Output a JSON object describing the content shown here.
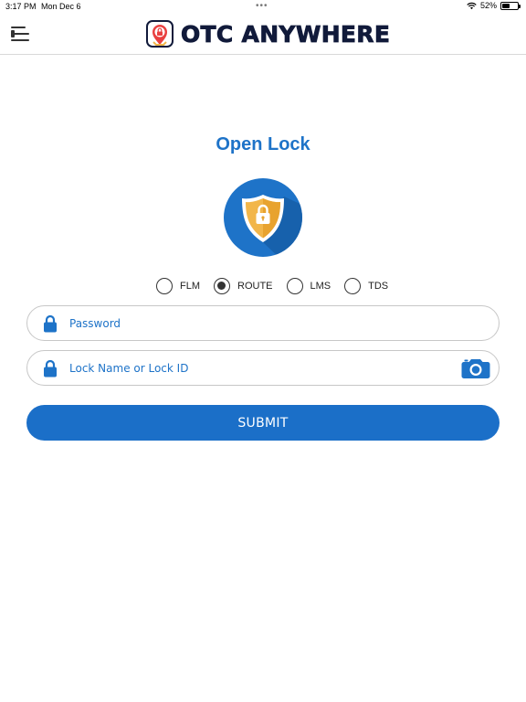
{
  "status_bar": {
    "time": "3:17 PM",
    "date": "Mon Dec 6",
    "battery_percent": "52%",
    "battery_level": 0.52,
    "icons": [
      "wifi-icon",
      "battery-icon"
    ]
  },
  "header": {
    "brand_name": "OTC ANYWHERE",
    "menu_icon": "menu-icon",
    "logo_icon": "lock-pin-logo-icon"
  },
  "main": {
    "title": "Open Lock",
    "emblem_icon": "shield-lock-icon",
    "lock_types": [
      {
        "label": "FLM",
        "selected": false
      },
      {
        "label": "ROUTE",
        "selected": true
      },
      {
        "label": "LMS",
        "selected": false
      },
      {
        "label": "TDS",
        "selected": false
      }
    ],
    "password": {
      "placeholder": "Password",
      "value": "",
      "icon": "lock-icon"
    },
    "lock_id": {
      "placeholder": "Lock Name or Lock ID",
      "value": "",
      "icon": "lock-icon",
      "action_icon": "camera-icon"
    },
    "submit_label": "SUBMIT"
  },
  "colors": {
    "accent": "#1e73c8",
    "button": "#1b6fc8",
    "brand_text": "#111a3a",
    "shield_gold": "#f2b64a"
  }
}
